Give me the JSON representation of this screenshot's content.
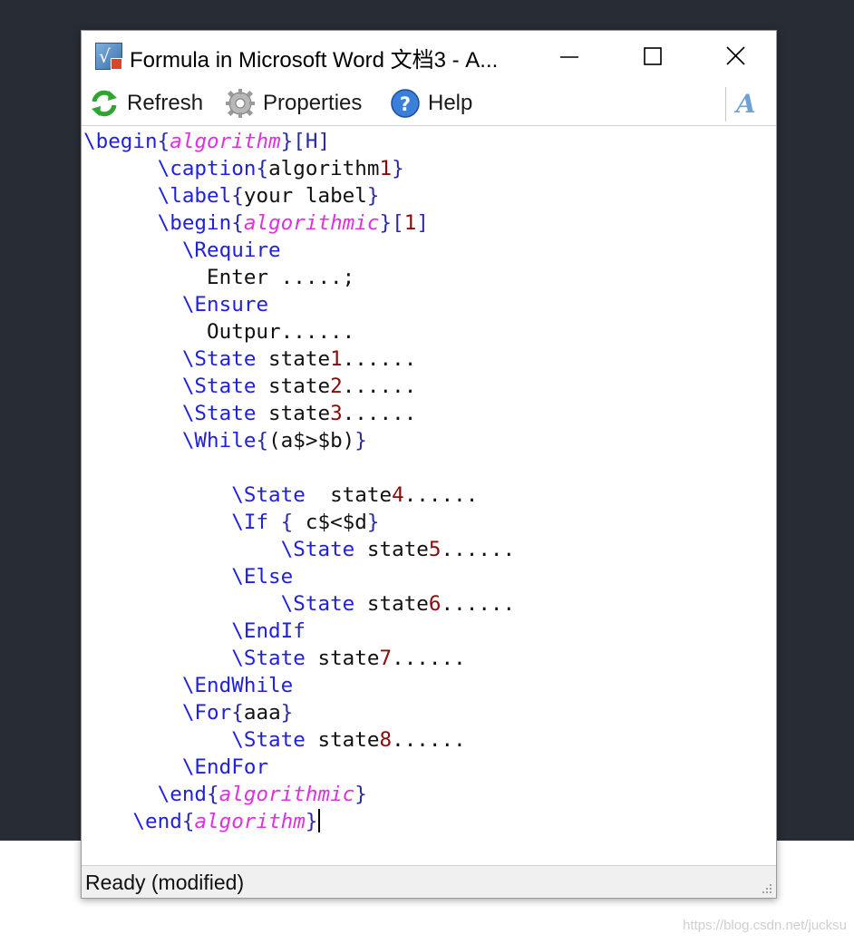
{
  "window": {
    "title": "Formula in Microsoft Word 文档3 - A...",
    "controls": [
      "minimize",
      "maximize",
      "close"
    ]
  },
  "toolbar": {
    "refresh_label": "Refresh",
    "properties_label": "Properties",
    "help_label": "Help",
    "font_icon": "italic-A-icon"
  },
  "editor": {
    "lines": [
      [
        {
          "t": "kw",
          "s": "\\begin"
        },
        {
          "t": "br",
          "s": "{"
        },
        {
          "t": "env",
          "s": "algorithm"
        },
        {
          "t": "br",
          "s": "}[H]"
        }
      ],
      [
        {
          "t": "txt",
          "s": "      "
        },
        {
          "t": "kw",
          "s": "\\caption"
        },
        {
          "t": "br",
          "s": "{"
        },
        {
          "t": "txt",
          "s": "algorithm"
        },
        {
          "t": "num",
          "s": "1"
        },
        {
          "t": "br",
          "s": "}"
        }
      ],
      [
        {
          "t": "txt",
          "s": "      "
        },
        {
          "t": "kw",
          "s": "\\label"
        },
        {
          "t": "br",
          "s": "{"
        },
        {
          "t": "txt",
          "s": "your label"
        },
        {
          "t": "br",
          "s": "}"
        }
      ],
      [
        {
          "t": "txt",
          "s": "      "
        },
        {
          "t": "kw",
          "s": "\\begin"
        },
        {
          "t": "br",
          "s": "{"
        },
        {
          "t": "env",
          "s": "algorithmic"
        },
        {
          "t": "br",
          "s": "}["
        },
        {
          "t": "num",
          "s": "1"
        },
        {
          "t": "br",
          "s": "]"
        }
      ],
      [
        {
          "t": "txt",
          "s": "        "
        },
        {
          "t": "kw",
          "s": "\\Require"
        }
      ],
      [
        {
          "t": "txt",
          "s": "          Enter .....;"
        }
      ],
      [
        {
          "t": "txt",
          "s": "        "
        },
        {
          "t": "kw",
          "s": "\\Ensure"
        }
      ],
      [
        {
          "t": "txt",
          "s": "          Outpur......"
        }
      ],
      [
        {
          "t": "txt",
          "s": "        "
        },
        {
          "t": "kw",
          "s": "\\State"
        },
        {
          "t": "txt",
          "s": " state"
        },
        {
          "t": "num",
          "s": "1"
        },
        {
          "t": "txt",
          "s": "......"
        }
      ],
      [
        {
          "t": "txt",
          "s": "        "
        },
        {
          "t": "kw",
          "s": "\\State"
        },
        {
          "t": "txt",
          "s": " state"
        },
        {
          "t": "num",
          "s": "2"
        },
        {
          "t": "txt",
          "s": "......"
        }
      ],
      [
        {
          "t": "txt",
          "s": "        "
        },
        {
          "t": "kw",
          "s": "\\State"
        },
        {
          "t": "txt",
          "s": " state"
        },
        {
          "t": "num",
          "s": "3"
        },
        {
          "t": "txt",
          "s": "......"
        }
      ],
      [
        {
          "t": "txt",
          "s": "        "
        },
        {
          "t": "kw",
          "s": "\\While"
        },
        {
          "t": "br",
          "s": "{"
        },
        {
          "t": "txt",
          "s": "(a$>$b)"
        },
        {
          "t": "br",
          "s": "}"
        }
      ],
      [
        {
          "t": "txt",
          "s": " "
        }
      ],
      [
        {
          "t": "txt",
          "s": "            "
        },
        {
          "t": "kw",
          "s": "\\State"
        },
        {
          "t": "txt",
          "s": "  state"
        },
        {
          "t": "num",
          "s": "4"
        },
        {
          "t": "txt",
          "s": "......"
        }
      ],
      [
        {
          "t": "txt",
          "s": "            "
        },
        {
          "t": "kw",
          "s": "\\If"
        },
        {
          "t": "txt",
          "s": " "
        },
        {
          "t": "br",
          "s": "{"
        },
        {
          "t": "txt",
          "s": " c$<$d"
        },
        {
          "t": "br",
          "s": "}"
        }
      ],
      [
        {
          "t": "txt",
          "s": "                "
        },
        {
          "t": "kw",
          "s": "\\State"
        },
        {
          "t": "txt",
          "s": " state"
        },
        {
          "t": "num",
          "s": "5"
        },
        {
          "t": "txt",
          "s": "......"
        }
      ],
      [
        {
          "t": "txt",
          "s": "            "
        },
        {
          "t": "kw",
          "s": "\\Else"
        }
      ],
      [
        {
          "t": "txt",
          "s": "                "
        },
        {
          "t": "kw",
          "s": "\\State"
        },
        {
          "t": "txt",
          "s": " state"
        },
        {
          "t": "num",
          "s": "6"
        },
        {
          "t": "txt",
          "s": "......"
        }
      ],
      [
        {
          "t": "txt",
          "s": "            "
        },
        {
          "t": "kw",
          "s": "\\EndIf"
        }
      ],
      [
        {
          "t": "txt",
          "s": "            "
        },
        {
          "t": "kw",
          "s": "\\State"
        },
        {
          "t": "txt",
          "s": " state"
        },
        {
          "t": "num",
          "s": "7"
        },
        {
          "t": "txt",
          "s": "......"
        }
      ],
      [
        {
          "t": "txt",
          "s": "        "
        },
        {
          "t": "kw",
          "s": "\\EndWhile"
        }
      ],
      [
        {
          "t": "txt",
          "s": "        "
        },
        {
          "t": "kw",
          "s": "\\For"
        },
        {
          "t": "br",
          "s": "{"
        },
        {
          "t": "txt",
          "s": "aaa"
        },
        {
          "t": "br",
          "s": "}"
        }
      ],
      [
        {
          "t": "txt",
          "s": "            "
        },
        {
          "t": "kw",
          "s": "\\State"
        },
        {
          "t": "txt",
          "s": " state"
        },
        {
          "t": "num",
          "s": "8"
        },
        {
          "t": "txt",
          "s": "......"
        }
      ],
      [
        {
          "t": "txt",
          "s": "        "
        },
        {
          "t": "kw",
          "s": "\\EndFor"
        }
      ],
      [
        {
          "t": "txt",
          "s": "      "
        },
        {
          "t": "kw",
          "s": "\\end"
        },
        {
          "t": "br",
          "s": "{"
        },
        {
          "t": "env",
          "s": "algorithmic"
        },
        {
          "t": "br",
          "s": "}"
        }
      ],
      [
        {
          "t": "txt",
          "s": "    "
        },
        {
          "t": "kw",
          "s": "\\end"
        },
        {
          "t": "br",
          "s": "{"
        },
        {
          "t": "env",
          "s": "algorithm"
        },
        {
          "t": "br",
          "s": "}"
        },
        {
          "t": "caret",
          "s": ""
        }
      ]
    ]
  },
  "statusbar": {
    "text": "Ready (modified)"
  },
  "watermark": "https://blog.csdn.net/jucksu",
  "colors": {
    "keyword": "#2020e0",
    "brace": "#2a2aa8",
    "environment": "#e030e0",
    "number": "#8b0a0a",
    "background_dark": "#282c34"
  }
}
